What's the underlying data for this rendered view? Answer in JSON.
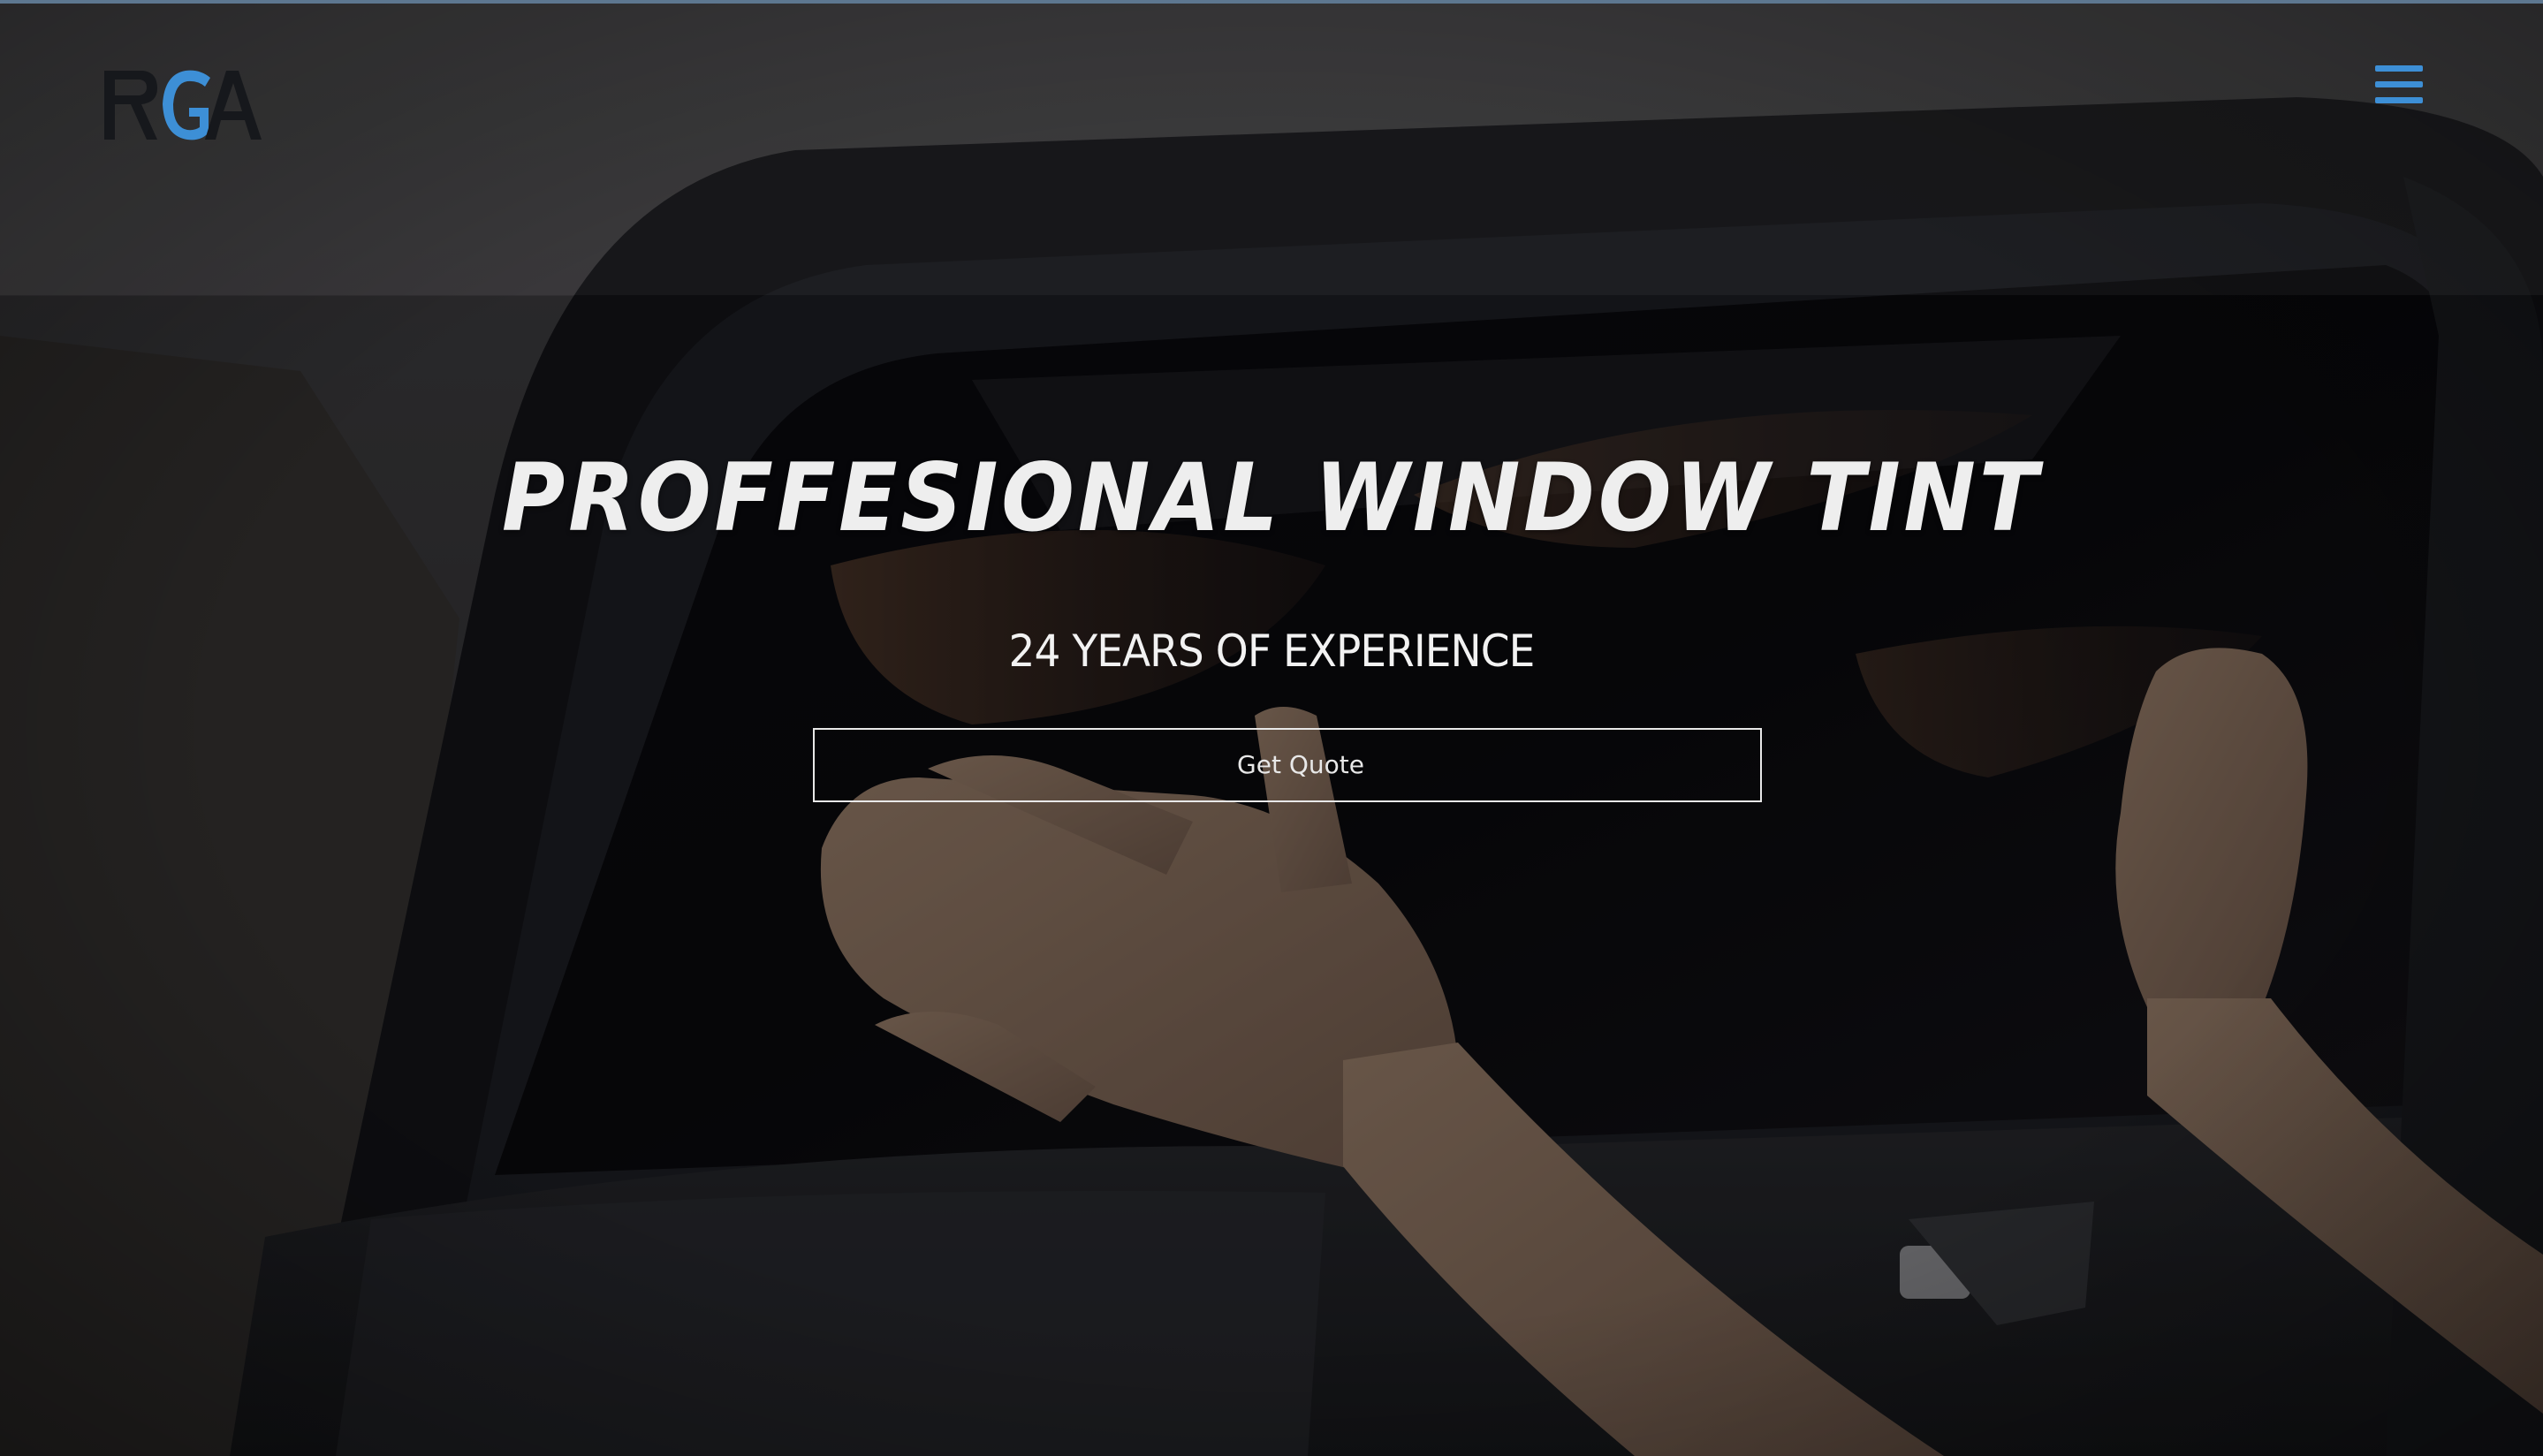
{
  "brand": {
    "logo_text": "RGA",
    "colors": {
      "logo_dark": "#16181c",
      "logo_accent": "#3d8fd6",
      "menu_icon": "#3d8fd6",
      "top_bar": "#5d7790"
    }
  },
  "header": {
    "menu_icon": "hamburger-menu-icon"
  },
  "hero": {
    "headline": "PROFFESIONAL WINDOW TINT",
    "subheadline": "24 YEARS OF  EXPERIENCE",
    "cta_label": "Get Quote",
    "background": "dimmed photo of hands applying tint film to a car side window"
  }
}
